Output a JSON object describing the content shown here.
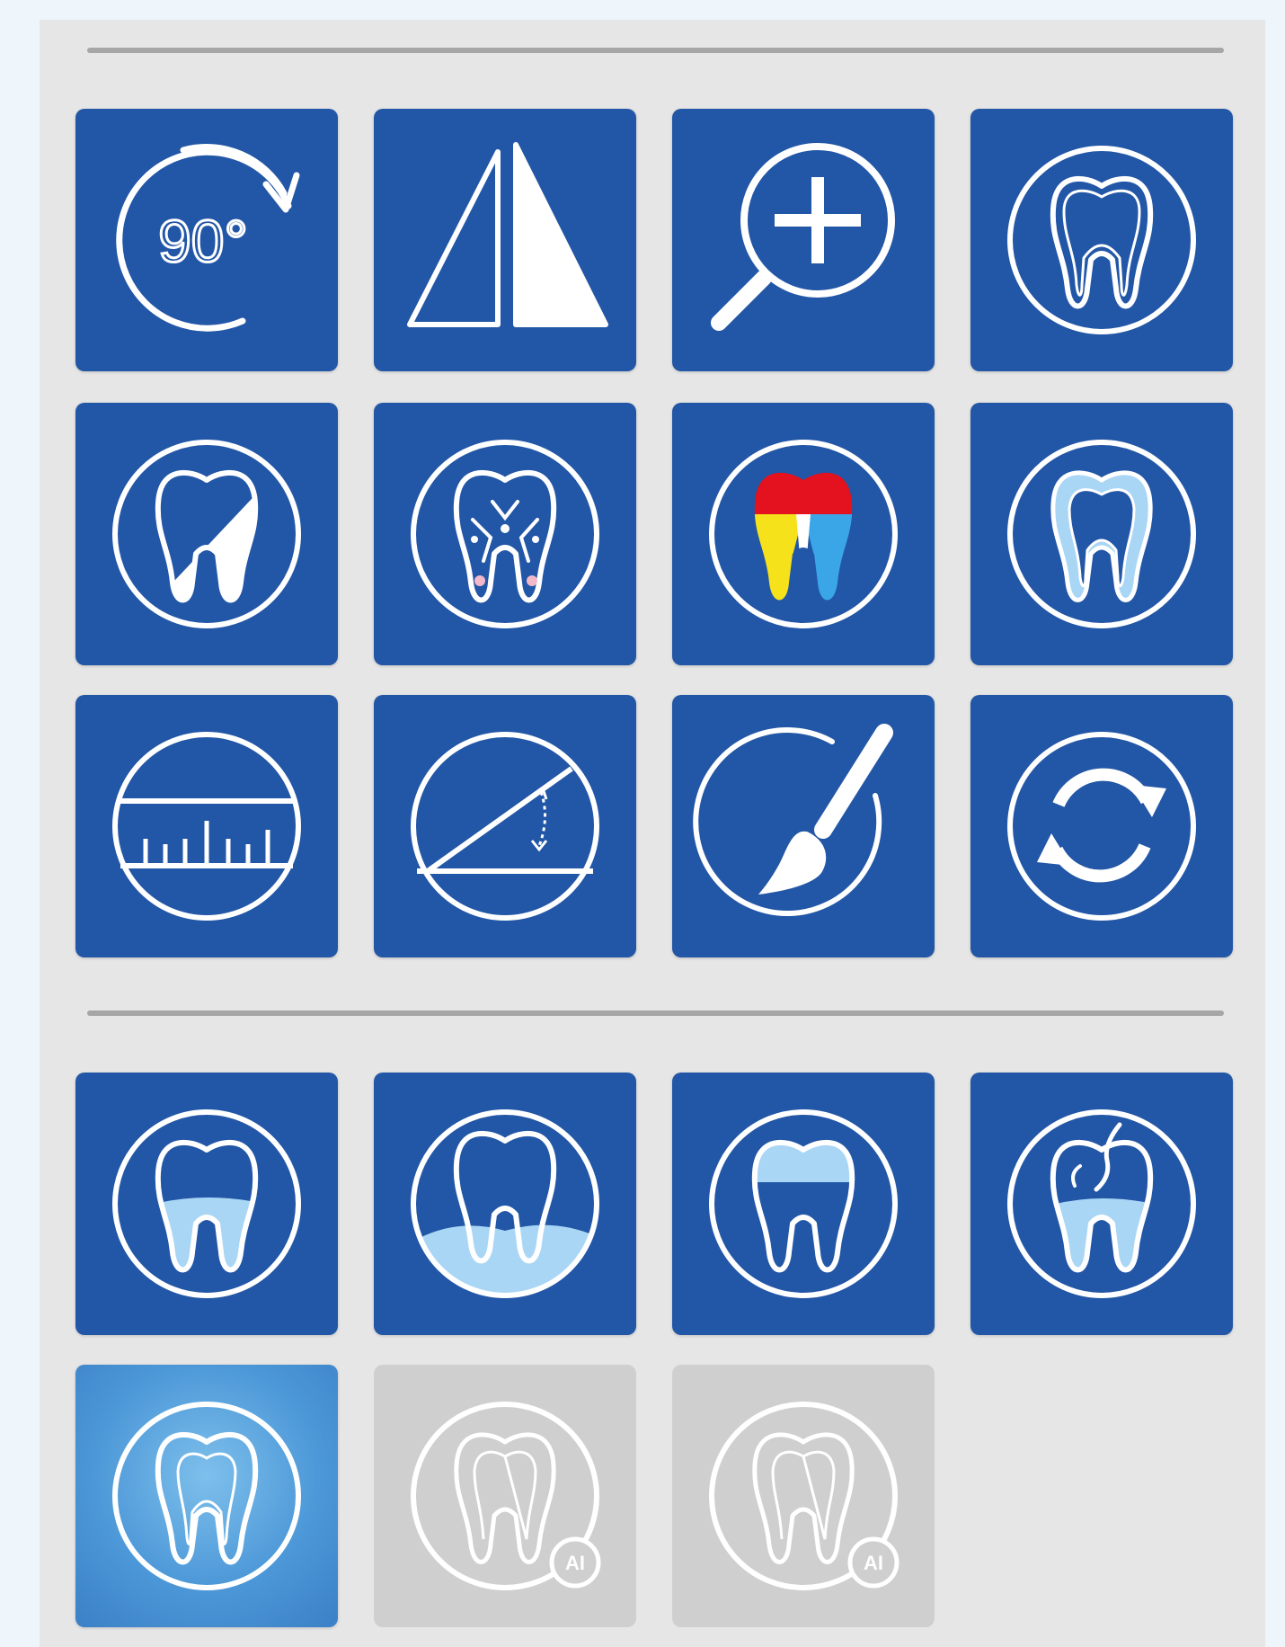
{
  "toolbar": {
    "rotate_label": "90°",
    "ai_badge": "AI",
    "colors": {
      "button_bg": "#2256a6",
      "button_active_bg": "#4d98d8",
      "button_disabled_bg": "#cfcfcf",
      "panel_bg": "#e6e6e6",
      "divider": "#a6a6a6",
      "icon_stroke": "#ffffff",
      "icon_light_fill": "#a9d6f5",
      "heatmap_red": "#e3121e",
      "heatmap_yellow": "#f6e21a",
      "heatmap_blue": "#3aa6e8"
    },
    "group_1_icons": [
      "rotate-90-icon",
      "mirror-flip-icon",
      "zoom-in-icon",
      "tooth-outline-icon",
      "tooth-half-fill-icon",
      "tooth-caries-icon",
      "tooth-color-map-icon",
      "tooth-enamel-icon",
      "ruler-measure-icon",
      "angle-measure-icon",
      "brush-draw-icon",
      "refresh-reset-icon"
    ],
    "group_2_icons": [
      "tooth-root-fill-icon",
      "tooth-bone-level-icon",
      "tooth-crown-fill-icon",
      "tooth-fracture-icon",
      "tooth-canal-icon",
      "tooth-ai-icon",
      "tooth-ai-icon"
    ],
    "group_2_states": [
      "normal",
      "normal",
      "normal",
      "normal",
      "active",
      "disabled",
      "disabled"
    ]
  }
}
